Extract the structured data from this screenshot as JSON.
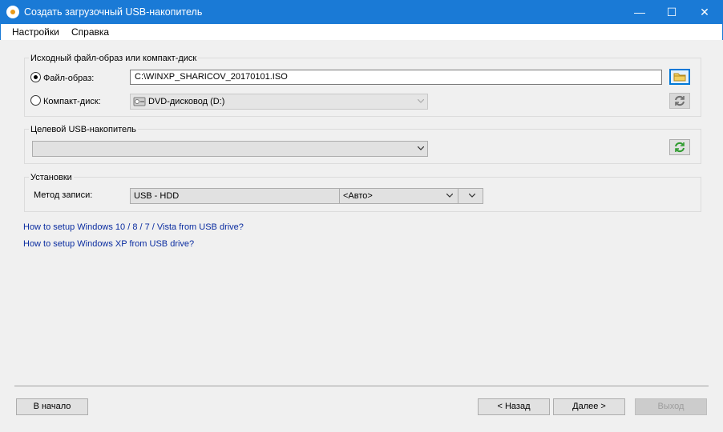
{
  "window": {
    "title": "Создать загрузочный USB-накопитель",
    "controls": {
      "minimize": "—",
      "maximize": "☐",
      "close": "✕"
    }
  },
  "menu": {
    "items": [
      "Настройки",
      "Справка"
    ]
  },
  "source_group": {
    "caption": "Исходный файл-образ или компакт-диск",
    "image_option": {
      "label": "Файл-образ:",
      "selected": true,
      "value": "C:\\WINXP_SHARICOV_20170101.ISO"
    },
    "cd_option": {
      "label": "Компакт-диск:",
      "selected": false,
      "value": "DVD-дисковод (D:)"
    },
    "browse_icon": "folder-icon",
    "refresh_icon": "refresh-icon"
  },
  "target_group": {
    "caption": "Целевой USB-накопитель",
    "value": "",
    "refresh_icon": "refresh-icon"
  },
  "settings_group": {
    "caption": "Установки",
    "method_label": "Метод записи:",
    "method_value": "USB - HDD",
    "mode_value": "<Авто>",
    "extra_value": ""
  },
  "links": [
    "How to setup Windows 10 / 8 / 7 / Vista from USB drive?",
    "How to setup Windows XP from USB drive?"
  ],
  "footer": {
    "home_label": "В начало",
    "back_label": "< Назад",
    "next_label": "Далее >",
    "exit_label": "Выход"
  },
  "colors": {
    "titlebar": "#1a7ad6",
    "link": "#0a2ca0",
    "focus_border": "#0078d7",
    "refresh_green": "#2e9b2e"
  }
}
